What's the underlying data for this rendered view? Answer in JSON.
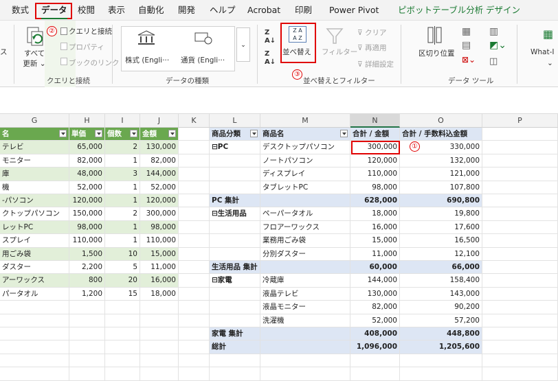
{
  "menu": [
    "数式",
    "データ",
    "校閲",
    "表示",
    "自動化",
    "開発",
    "ヘルプ",
    "Acrobat",
    "印刷",
    "Power Pivot",
    "ピボットテーブル分析",
    "デザイン"
  ],
  "ribbon": {
    "left_partial": "ス",
    "query_labels": [
      "クエリと接続",
      "プロパティ",
      "ブックのリンク"
    ],
    "refresh_all": [
      "すべて",
      "更新 ⌄"
    ],
    "group_query": "クエリと接続",
    "datatype_stock": "株式 (Engli···",
    "datatype_currency": "通貨 (Engli···",
    "group_datatype": "データの種類",
    "sort": "並べ替え",
    "filter": "フィルター",
    "clear": "クリア",
    "reapply": "再適用",
    "advanced": "詳細設定",
    "group_sortfilter": "並べ替えとフィルター",
    "text_to_columns": "区切り位置",
    "group_datatools": "データ ツール",
    "whatif": "What-I",
    "badge1": "①",
    "badge2": "②",
    "badge3": "③"
  },
  "columns": [
    "G",
    "H",
    "I",
    "J",
    "K",
    "L",
    "M",
    "N",
    "O",
    "P"
  ],
  "left_table": {
    "headers": [
      "名",
      "単価",
      "個数",
      "金額"
    ],
    "rows": [
      [
        "テレビ",
        "65,000",
        "2",
        "130,000"
      ],
      [
        "モニター",
        "82,000",
        "1",
        "82,000"
      ],
      [
        "庫",
        "48,000",
        "3",
        "144,000"
      ],
      [
        "機",
        "52,000",
        "1",
        "52,000"
      ],
      [
        "-パソコン",
        "120,000",
        "1",
        "120,000"
      ],
      [
        "クトップパソコン",
        "150,000",
        "2",
        "300,000"
      ],
      [
        "レットPC",
        "98,000",
        "1",
        "98,000"
      ],
      [
        "スプレイ",
        "110,000",
        "1",
        "110,000"
      ],
      [
        "用ごみ袋",
        "1,500",
        "10",
        "15,000"
      ],
      [
        "ダスター",
        "2,200",
        "5",
        "11,000"
      ],
      [
        "アーワックス",
        "800",
        "20",
        "16,000"
      ],
      [
        "パータオル",
        "1,200",
        "15",
        "18,000"
      ]
    ]
  },
  "pivot": {
    "headers": [
      "商品分類",
      "商品名",
      "合計 / 金額",
      "合計 / 手数料込金額"
    ],
    "rows": [
      {
        "cat": "⊟PC",
        "name": "デスクトップパソコン",
        "amt": "300,000",
        "fee": "330,000",
        "type": "item"
      },
      {
        "cat": "",
        "name": "ノートパソコン",
        "amt": "120,000",
        "fee": "132,000",
        "type": "item"
      },
      {
        "cat": "",
        "name": "ディスプレイ",
        "amt": "110,000",
        "fee": "121,000",
        "type": "item"
      },
      {
        "cat": "",
        "name": "タブレットPC",
        "amt": "98,000",
        "fee": "107,800",
        "type": "item"
      },
      {
        "cat": "PC 集計",
        "name": "",
        "amt": "628,000",
        "fee": "690,800",
        "type": "total"
      },
      {
        "cat": "⊟生活用品",
        "name": "ペーパータオル",
        "amt": "18,000",
        "fee": "19,800",
        "type": "item"
      },
      {
        "cat": "",
        "name": "フロアーワックス",
        "amt": "16,000",
        "fee": "17,600",
        "type": "item"
      },
      {
        "cat": "",
        "name": "業務用ごみ袋",
        "amt": "15,000",
        "fee": "16,500",
        "type": "item"
      },
      {
        "cat": "",
        "name": "分別ダスター",
        "amt": "11,000",
        "fee": "12,100",
        "type": "item"
      },
      {
        "cat": "生活用品 集計",
        "name": "",
        "amt": "60,000",
        "fee": "66,000",
        "type": "total"
      },
      {
        "cat": "⊟家電",
        "name": "冷蔵庫",
        "amt": "144,000",
        "fee": "158,400",
        "type": "item"
      },
      {
        "cat": "",
        "name": "液晶テレビ",
        "amt": "130,000",
        "fee": "143,000",
        "type": "item"
      },
      {
        "cat": "",
        "name": "液晶モニター",
        "amt": "82,000",
        "fee": "90,200",
        "type": "item"
      },
      {
        "cat": "",
        "name": "洗濯機",
        "amt": "52,000",
        "fee": "57,200",
        "type": "item"
      },
      {
        "cat": "家電 集計",
        "name": "",
        "amt": "408,000",
        "fee": "448,800",
        "type": "total"
      },
      {
        "cat": "総計",
        "name": "",
        "amt": "1,096,000",
        "fee": "1,205,600",
        "type": "grand"
      }
    ]
  },
  "colors": {
    "accent": "#e00000",
    "table_header": "#6aa84f",
    "table_band": "#e2efd9",
    "pivot_header": "#dde6f4",
    "active_tab": "#1a7a32"
  }
}
